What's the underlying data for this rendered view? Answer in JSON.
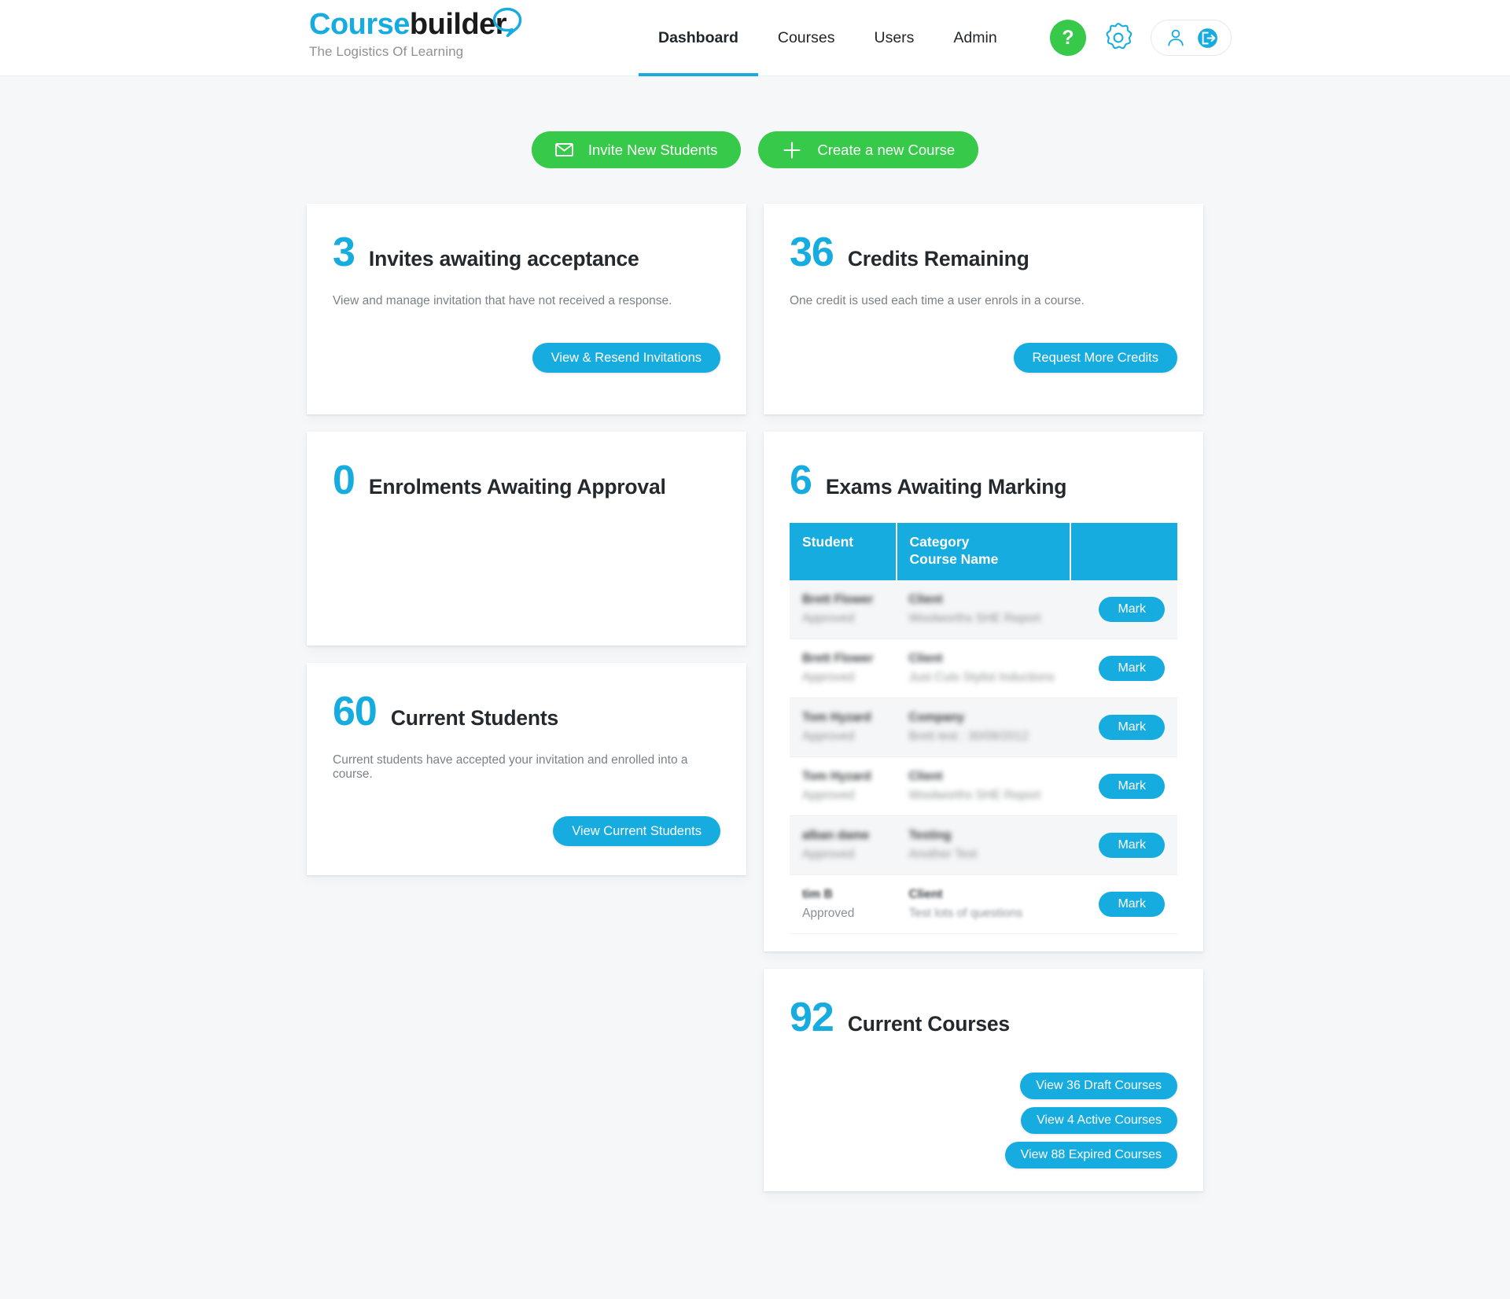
{
  "brand": {
    "name_part1": "Course",
    "name_part2": "builder",
    "tagline": "The Logistics Of Learning"
  },
  "nav": {
    "items": [
      {
        "label": "Dashboard",
        "active": true
      },
      {
        "label": "Courses",
        "active": false
      },
      {
        "label": "Users",
        "active": false
      },
      {
        "label": "Admin",
        "active": false
      }
    ]
  },
  "topicons": {
    "help": "?",
    "help_name": "help-icon",
    "gear_name": "gear-icon",
    "user_name": "user-icon",
    "logout_name": "logout-icon"
  },
  "actions": {
    "invite_label": "Invite New Students",
    "create_label": "Create a new Course"
  },
  "cards": {
    "invites": {
      "number": "3",
      "title": "Invites awaiting acceptance",
      "text": "View and manage invitation that have not received a response.",
      "button": "View & Resend Invitations"
    },
    "credits": {
      "number": "36",
      "title": "Credits Remaining",
      "text": "One credit is used each time a user enrols in a course.",
      "button": "Request More Credits"
    },
    "enrolments": {
      "number": "0",
      "title": "Enrolments Awaiting Approval"
    },
    "students": {
      "number": "60",
      "title": "Current Students",
      "text": "Current students have accepted your invitation and enrolled into a course.",
      "button": "View Current Students"
    },
    "exams": {
      "number": "6",
      "title": "Exams Awaiting Marking",
      "columns": [
        "Student",
        "Category\nCourse Name",
        ""
      ],
      "col_student": "Student",
      "col_category_line1": "Category",
      "col_category_line2": "Course Name",
      "action_label": "Mark",
      "rows": [
        {
          "student": "Brett Flower",
          "status": "Approved",
          "category": "Client",
          "course": "Woolworths SHE Report"
        },
        {
          "student": "Brett Flower",
          "status": "Approved",
          "category": "Client",
          "course": "Just Cuts Stylist Inductions"
        },
        {
          "student": "Tom Hyzard",
          "status": "Approved",
          "category": "Company",
          "course": "Brett test : 30/08/2012"
        },
        {
          "student": "Tom Hyzard",
          "status": "Approved",
          "category": "Client",
          "course": "Woolworths SHE Report"
        },
        {
          "student": "alban dame",
          "status": "Approved",
          "category": "Testing",
          "course": "Another Test"
        },
        {
          "student": "tim B",
          "status": "Approved",
          "category": "Client",
          "course": "Test lots of questions"
        }
      ]
    },
    "courses": {
      "number": "92",
      "title": "Current Courses",
      "button_draft": "View 36 Draft Courses",
      "button_active": "View 4 Active Courses",
      "button_expired": "View 88 Expired Courses"
    }
  },
  "colors": {
    "brand_blue": "#17ace0",
    "brand_green": "#36c94a",
    "page_bg": "#f5f7f9",
    "heading": "#24292e",
    "muted": "#7b8287"
  }
}
